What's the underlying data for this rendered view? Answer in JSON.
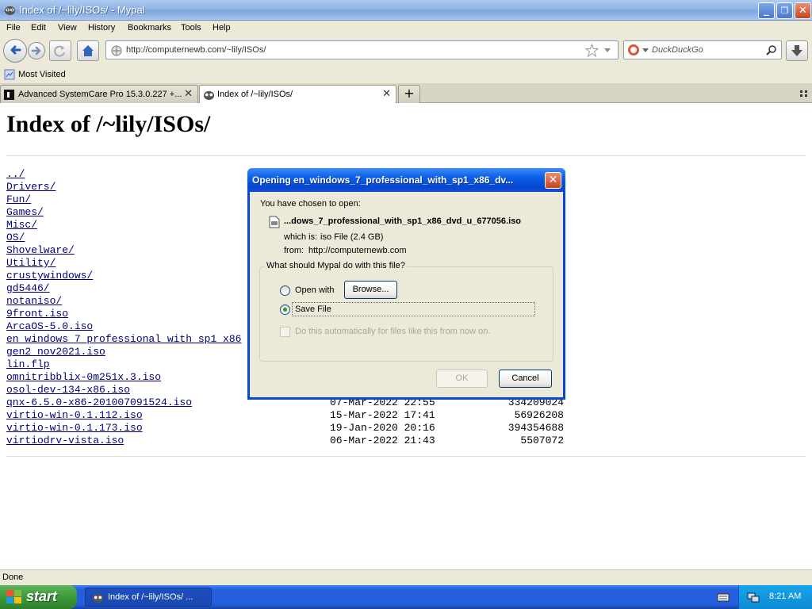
{
  "window": {
    "title": "Index of /~lily/ISOs/ - Mypal",
    "minimize": "_",
    "maximize": "❐",
    "close": "✕"
  },
  "menu": [
    "File",
    "Edit",
    "View",
    "History",
    "Bookmarks",
    "Tools",
    "Help"
  ],
  "nav": {
    "url": "http://computernewb.com/~lily/ISOs/",
    "search_placeholder": "DuckDuckGo"
  },
  "bookmarks": {
    "most_visited": "Most Visited"
  },
  "tabs": [
    {
      "label": "Advanced SystemCare Pro 15.3.0.227 +...",
      "close": "✕"
    },
    {
      "label": "Index of /~lily/ISOs/",
      "close": "✕"
    }
  ],
  "tab_new": "+",
  "page": {
    "heading": "Index of /~lily/ISOs/",
    "entries": [
      {
        "name": "../",
        "date": "",
        "size": ""
      },
      {
        "name": "Drivers/",
        "date": "",
        "size": ""
      },
      {
        "name": "Fun/",
        "date": "",
        "size": ""
      },
      {
        "name": "Games/",
        "date": "",
        "size": ""
      },
      {
        "name": "Misc/",
        "date": "",
        "size": ""
      },
      {
        "name": "OS/",
        "date": "",
        "size": ""
      },
      {
        "name": "Shovelware/",
        "date": "",
        "size": ""
      },
      {
        "name": "Utility/",
        "date": "",
        "size": ""
      },
      {
        "name": "crustywindows/",
        "date": "",
        "size": ""
      },
      {
        "name": "gd5446/",
        "date": "",
        "size": ""
      },
      {
        "name": "notaniso/",
        "date": "",
        "size": ""
      },
      {
        "name": "9front.iso",
        "date": "",
        "size": ""
      },
      {
        "name": "ArcaOS-5.0.iso",
        "date": "",
        "size": ""
      },
      {
        "name": "en windows 7 professional with sp1 x86",
        "date": "",
        "size": ""
      },
      {
        "name": "gen2 nov2021.iso",
        "date": "",
        "size": ""
      },
      {
        "name": "lin.flp",
        "date": "",
        "size": ""
      },
      {
        "name": "omnitribblix-0m251x.3.iso",
        "date": "",
        "size": ""
      },
      {
        "name": "osol-dev-134-x86.iso",
        "date": "",
        "size": ""
      },
      {
        "name": "qnx-6.5.0-x86-201007091524.iso",
        "date": "07-Mar-2022 22:55",
        "size": "334209024"
      },
      {
        "name": "virtio-win-0.1.112.iso",
        "date": "15-Mar-2022 17:41",
        "size": "56926208"
      },
      {
        "name": "virtio-win-0.1.173.iso",
        "date": "19-Jan-2020 20:16",
        "size": "394354688"
      },
      {
        "name": "virtiodrv-vista.iso",
        "date": "06-Mar-2022 21:43",
        "size": "5507072"
      }
    ]
  },
  "dialog": {
    "title": "Opening en_windows_7_professional_with_sp1_x86_dv...",
    "chosen_text": "You have chosen to open:",
    "file_name": "...dows_7_professional_with_sp1_x86_dvd_u_677056.iso",
    "which_is_label": "which is:",
    "which_is_value": "iso File (2.4 GB)",
    "from_label": "from:",
    "from_value": "http://computernewb.com",
    "question": "What should Mypal do with this file?",
    "open_with": "Open with",
    "browse": "Browse...",
    "save_file": "Save File",
    "auto_checkbox": "Do this automatically for files like this from now on.",
    "ok": "OK",
    "cancel": "Cancel",
    "selected_option": "Save File"
  },
  "status": {
    "text": "Done"
  },
  "taskbar": {
    "start": "start",
    "task": "Index of /~lily/ISOs/ ...",
    "clock": "8:21 AM"
  },
  "colors": {
    "titlebar": "#8fb3e6",
    "dialog_title": "#0a5fe8",
    "link": "#000080",
    "taskbar": "#245edc",
    "start": "#3c9a39"
  }
}
